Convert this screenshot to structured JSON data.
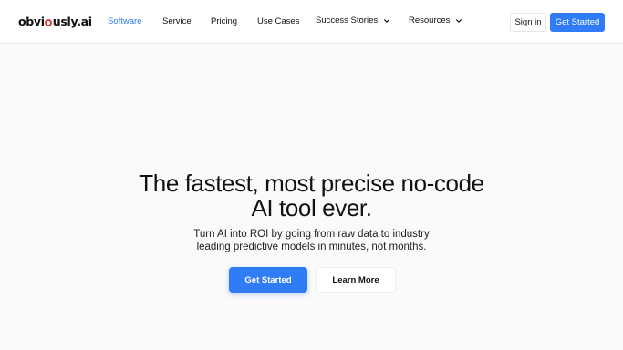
{
  "header": {
    "logo_text_pre": "obvi",
    "logo_text_post": "usly.ai",
    "nav": [
      {
        "label": "Software",
        "active": true
      },
      {
        "label": "Service"
      },
      {
        "label": "Pricing"
      },
      {
        "label": "Use Cases"
      },
      {
        "label": "Success Stories",
        "dropdown": true
      },
      {
        "label": "Resources",
        "dropdown": true
      }
    ],
    "sign_in": "Sign in",
    "get_started": "Get Started"
  },
  "hero": {
    "title": "The fastest, most precise no-code AI tool ever.",
    "subtitle": "Turn AI into ROI by going from raw data to industry leading predictive models in minutes, not months.",
    "primary_button": "Get Started",
    "secondary_button": "Learn More"
  },
  "colors": {
    "accent": "#2f7cf6",
    "logo_dot": "#e53935",
    "background": "#fafafb"
  }
}
